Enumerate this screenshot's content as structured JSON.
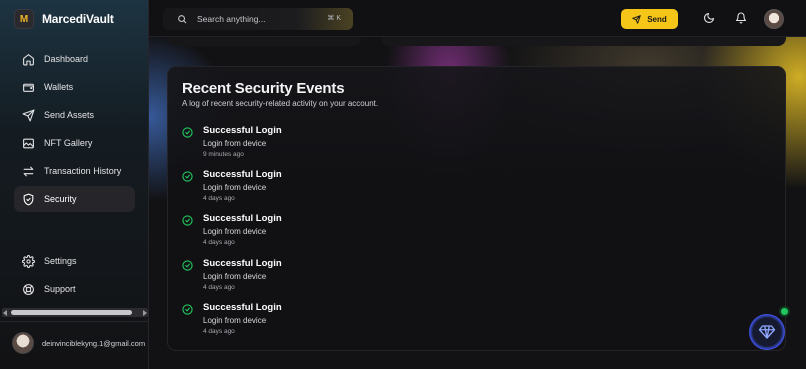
{
  "app": {
    "name": "MarcediVault",
    "logo_letter": "M"
  },
  "sidebar": {
    "items": [
      {
        "label": "Dashboard",
        "icon": "home-icon"
      },
      {
        "label": "Wallets",
        "icon": "wallet-icon"
      },
      {
        "label": "Send Assets",
        "icon": "send-icon"
      },
      {
        "label": "NFT Gallery",
        "icon": "image-icon"
      },
      {
        "label": "Transaction History",
        "icon": "arrows-exchange-icon"
      },
      {
        "label": "Security",
        "icon": "shield-icon",
        "active": true
      }
    ],
    "bottom_items": [
      {
        "label": "Settings",
        "icon": "gear-icon"
      },
      {
        "label": "Support",
        "icon": "lifebuoy-icon"
      }
    ],
    "user_email": "deinvinciblekyng.1@gmail.com"
  },
  "topbar": {
    "search_placeholder": "Search anything...",
    "shortcut": "⌘ K",
    "send_label": "Send"
  },
  "security_events": {
    "title": "Recent Security Events",
    "subtitle": "A log of recent security-related activity on your account.",
    "events": [
      {
        "title": "Successful Login",
        "description": "Login from device",
        "time": "9 minutes ago"
      },
      {
        "title": "Successful Login",
        "description": "Login from device",
        "time": "4 days ago"
      },
      {
        "title": "Successful Login",
        "description": "Login from device",
        "time": "4 days ago"
      },
      {
        "title": "Successful Login",
        "description": "Login from device",
        "time": "4 days ago"
      },
      {
        "title": "Successful Login",
        "description": "Login from device",
        "time": "4 days ago"
      }
    ]
  },
  "colors": {
    "accent": "#f5c518",
    "success": "#22c55e",
    "background": "#121214"
  }
}
